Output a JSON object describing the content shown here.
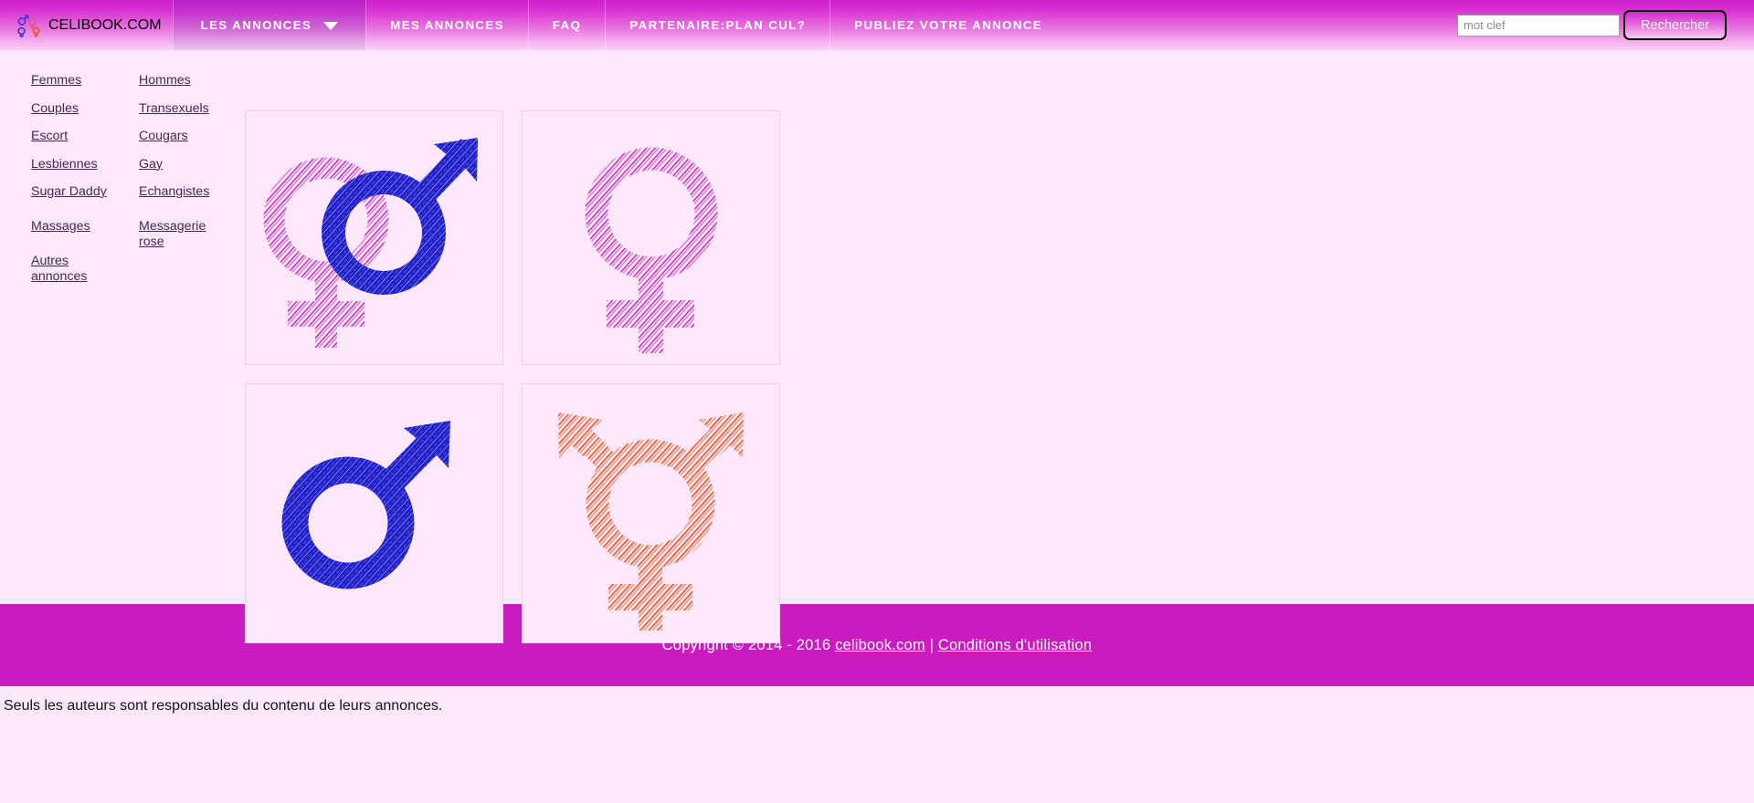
{
  "header": {
    "logo_icon": "gender-symbols-icon",
    "brand": "CELIBOOK.COM",
    "nav": [
      {
        "label": "LES ANNONCES",
        "active": true,
        "caret": true
      },
      {
        "label": "MES ANNONCES",
        "active": false,
        "caret": false
      },
      {
        "label": "FAQ",
        "active": false,
        "caret": false
      },
      {
        "label": "PARTENAIRE:PLAN CUL?",
        "active": false,
        "caret": false
      },
      {
        "label": "PUBLIEZ VOTRE ANNONCE",
        "active": false,
        "caret": false
      }
    ],
    "search": {
      "placeholder": "mot clef",
      "value": "",
      "button_label": "Rechercher"
    }
  },
  "sidebar": {
    "column_left": [
      {
        "label": "Femmes"
      },
      {
        "label": "Couples"
      },
      {
        "label": "Escort"
      },
      {
        "label": "Lesbiennes"
      },
      {
        "label": "Sugar Daddy"
      },
      {
        "label": "Massages"
      },
      {
        "label": "Autres annonces"
      }
    ],
    "column_right": [
      {
        "label": "Hommes"
      },
      {
        "label": "Transexuels"
      },
      {
        "label": "Cougars"
      },
      {
        "label": "Gay"
      },
      {
        "label": "Echangistes"
      },
      {
        "label": "Messagerie rose"
      }
    ]
  },
  "tiles": [
    {
      "name": "couple-symbol-tile",
      "icon": "female-male-couple-symbol",
      "colors": [
        "#cc2bbf",
        "#2222cc"
      ]
    },
    {
      "name": "female-symbol-tile",
      "icon": "female-symbol",
      "colors": [
        "#cc2bbf"
      ]
    },
    {
      "name": "male-symbol-tile",
      "icon": "male-symbol",
      "colors": [
        "#2222cc"
      ]
    },
    {
      "name": "transgender-symbol-tile",
      "icon": "transgender-symbol",
      "colors": [
        "#f2511b"
      ]
    }
  ],
  "footer": {
    "copyright_prefix": "Copyright © 2014 - 2016 ",
    "site_link": "celibook.com",
    "separator": " | ",
    "terms_link": "Conditions d'utilisation"
  },
  "disclaimer": "Seuls les auteurs sont responsables du contenu de leurs annonces.",
  "colors": {
    "page_background": "#fde8fb",
    "header_top": "#cc1ec9",
    "header_bottom": "#fbd2f6",
    "footer_bar": "#cc1ac1",
    "link_text": "#3d2a5c",
    "tile_border": "#f3cdee",
    "accent_pink": "#cc2bbf",
    "accent_blue": "#2222cc",
    "accent_orange": "#f2511b"
  }
}
